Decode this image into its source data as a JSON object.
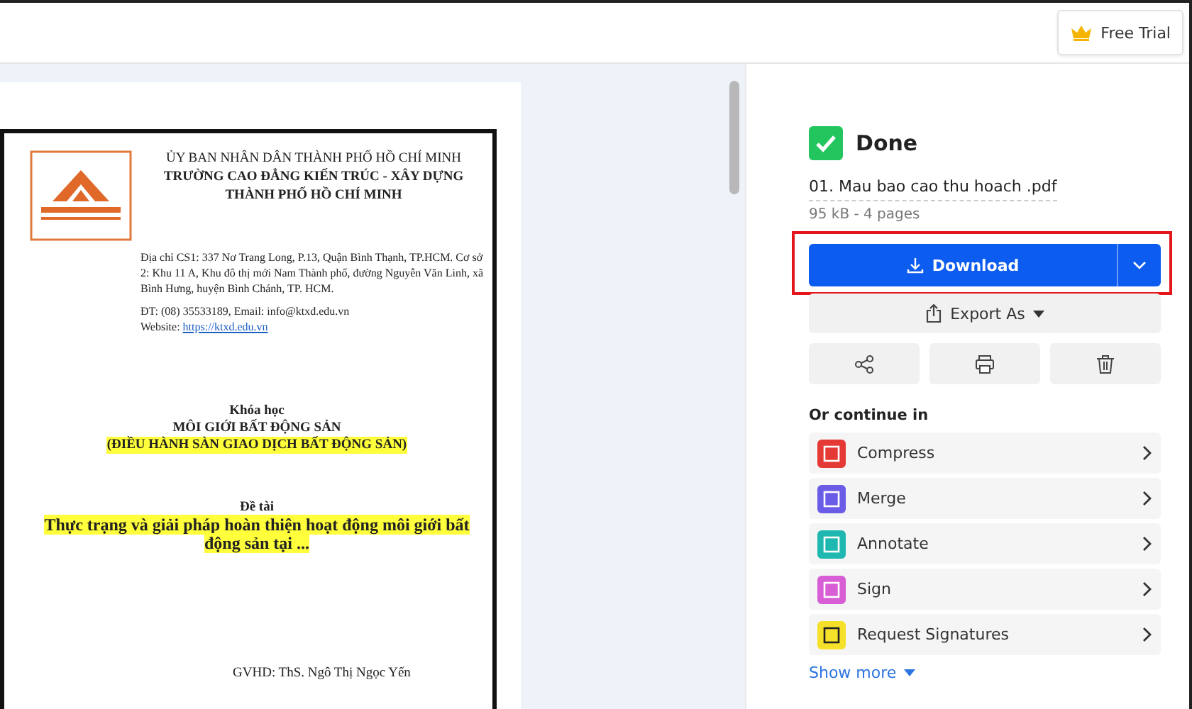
{
  "top_bar": {
    "trial_button": "Free Trial"
  },
  "document": {
    "header_lines": [
      "ỦY BAN NHÂN DÂN THÀNH PHỐ HỒ CHÍ MINH",
      "TRƯỜNG CAO ĐẲNG KIẾN TRÚC - XÂY DỰNG",
      "THÀNH PHỐ HỒ CHÍ MINH"
    ],
    "address": "Địa chỉ CS1: 337 Nơ Trang Long, P.13, Quận Bình Thạnh, TP.HCM. Cơ sở 2: Khu 11 A, Khu đô thị mới Nam Thành phố, đường Nguyễn Văn Linh, xã Bình Hưng, huyện Bình Chánh, TP. HCM.",
    "contact": "ĐT: (08) 35533189, Email: info@ktxd.edu.vn",
    "website_label": "Website:",
    "website_link": "https://ktxd.edu.vn",
    "course_label": "Khóa học",
    "course_title": "MÔI GIỚI BẤT ĐỘNG SẢN",
    "course_subtitle": "(ĐIỀU HÀNH SÀN GIAO DỊCH BẤT ĐỘNG SẢN)",
    "topic_label": "Đề tài",
    "topic": "Thực trạng và giải pháp hoàn thiện hoạt động môi giới bất động sản tại ...",
    "advisor": "GVHD: ThS. Ngô Thị Ngọc Yến"
  },
  "panel": {
    "status": "Done",
    "file_name": "01. Mau bao cao thu hoach .pdf",
    "file_meta": "95 kB - 4 pages",
    "download_button": "Download",
    "export_button": "Export As",
    "continue_heading": "Or continue in",
    "tools": [
      {
        "label": "Compress",
        "color": "#e53935"
      },
      {
        "label": "Merge",
        "color": "#6b5ce7"
      },
      {
        "label": "Annotate",
        "color": "#1fb8b0"
      },
      {
        "label": "Sign",
        "color": "#d85ed6"
      },
      {
        "label": "Request Signatures",
        "color": "#f5e12a"
      }
    ],
    "show_more": "Show more"
  }
}
